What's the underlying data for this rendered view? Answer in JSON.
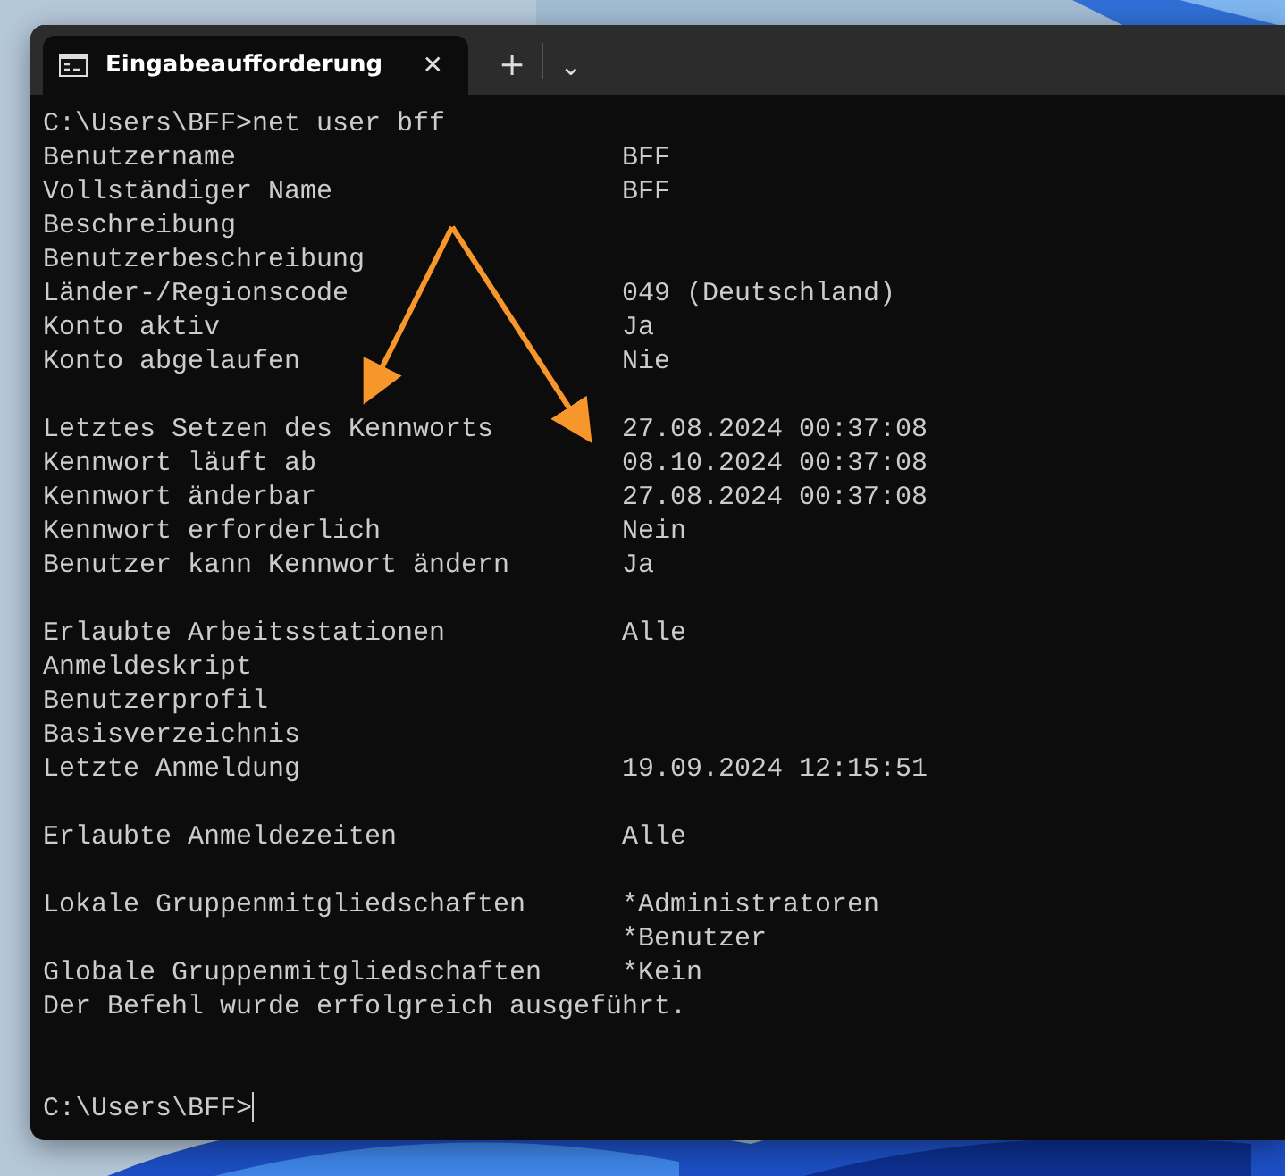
{
  "tab": {
    "title": "Eingabeaufforderung",
    "selected": true,
    "close": "✕"
  },
  "toolbar": {
    "new_tab": "+",
    "dropdown": "⌄"
  },
  "terminal": {
    "command_line": "C:\\Users\\BFF>net user bff",
    "lines": [
      {
        "kind": "pair",
        "label": "Benutzername",
        "value": "BFF"
      },
      {
        "kind": "pair",
        "label": "Vollständiger Name",
        "value": "BFF"
      },
      {
        "kind": "pair",
        "label": "Beschreibung"
      },
      {
        "kind": "pair",
        "label": "Benutzerbeschreibung"
      },
      {
        "kind": "pair",
        "label": "Länder-/Regionscode",
        "value": "049 (Deutschland)"
      },
      {
        "kind": "pair",
        "label": "Konto aktiv",
        "value": "Ja"
      },
      {
        "kind": "pair",
        "label": "Konto abgelaufen",
        "value": "Nie"
      },
      {
        "kind": "blank"
      },
      {
        "kind": "pair",
        "label": "Letztes Setzen des Kennworts",
        "value": "27.08.2024 00:37:08"
      },
      {
        "kind": "pair",
        "label": "Kennwort läuft ab",
        "value": "08.10.2024 00:37:08"
      },
      {
        "kind": "pair",
        "label": "Kennwort änderbar",
        "value": "27.08.2024 00:37:08"
      },
      {
        "kind": "pair",
        "label": "Kennwort erforderlich",
        "value": "Nein"
      },
      {
        "kind": "pair",
        "label": "Benutzer kann Kennwort ändern",
        "value": "Ja"
      },
      {
        "kind": "blank"
      },
      {
        "kind": "pair",
        "label": "Erlaubte Arbeitsstationen",
        "value": "Alle"
      },
      {
        "kind": "pair",
        "label": "Anmeldeskript"
      },
      {
        "kind": "pair",
        "label": "Benutzerprofil"
      },
      {
        "kind": "pair",
        "label": "Basisverzeichnis"
      },
      {
        "kind": "pair",
        "label": "Letzte Anmeldung",
        "value": "19.09.2024 12:15:51"
      },
      {
        "kind": "blank"
      },
      {
        "kind": "pair",
        "label": "Erlaubte Anmeldezeiten",
        "value": "Alle"
      },
      {
        "kind": "blank"
      },
      {
        "kind": "pair",
        "label": "Lokale Gruppenmitgliedschaften",
        "value": "*Administratoren"
      },
      {
        "kind": "pair",
        "value": "*Benutzer"
      },
      {
        "kind": "pair",
        "label": "Globale Gruppenmitgliedschaften",
        "value": "*Kein"
      },
      {
        "kind": "text",
        "text": "Der Befehl wurde erfolgreich ausgeführt."
      },
      {
        "kind": "blank"
      },
      {
        "kind": "blank"
      }
    ],
    "prompt": "C:\\Users\\BFF>"
  }
}
